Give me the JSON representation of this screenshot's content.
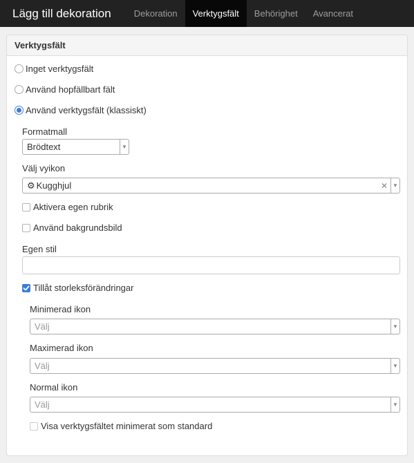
{
  "header": {
    "title": "Lägg till dekoration",
    "tabs": [
      {
        "label": "Dekoration",
        "active": false
      },
      {
        "label": "Verktygsfält",
        "active": true
      },
      {
        "label": "Behörighet",
        "active": false
      },
      {
        "label": "Avancerat",
        "active": false
      }
    ]
  },
  "panel": {
    "heading": "Verktygsfält",
    "toolbar_options": [
      {
        "label": "Inget verktygsfält",
        "selected": false
      },
      {
        "label": "Använd hopfällbart fält",
        "selected": false
      },
      {
        "label": "Använd verktygsfält (klassiskt)",
        "selected": true
      }
    ],
    "format": {
      "label": "Formatmall",
      "value": "Brödtext"
    },
    "view_icon": {
      "label": "Välj vyikon",
      "value": "Kugghjul",
      "icon": "gear-icon"
    },
    "custom_heading": {
      "label": "Aktivera egen rubrik",
      "checked": false
    },
    "background_image": {
      "label": "Använd bakgrundsbild",
      "checked": false
    },
    "custom_style": {
      "label": "Egen stil",
      "value": ""
    },
    "allow_resize": {
      "label": "Tillåt storleksförändringar",
      "checked": true
    },
    "minimized_icon": {
      "label": "Minimerad ikon",
      "placeholder": "Välj"
    },
    "maximized_icon": {
      "label": "Maximerad ikon",
      "placeholder": "Välj"
    },
    "normal_icon": {
      "label": "Normal ikon",
      "placeholder": "Välj"
    },
    "show_minimized": {
      "label": "Visa verktygsfältet minimerat som standard",
      "checked": false
    }
  },
  "colors": {
    "topbar": "#222222",
    "active_tab": "#080808",
    "accent": "#3a7ddb"
  }
}
